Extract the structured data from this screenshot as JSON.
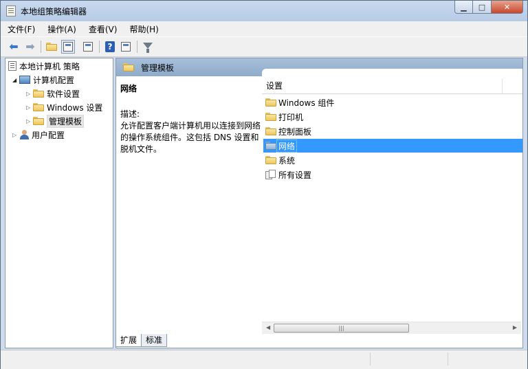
{
  "window": {
    "title": "本地组策略编辑器"
  },
  "menu": [
    "文件(F)",
    "操作(A)",
    "查看(V)",
    "帮助(H)"
  ],
  "toolbar": {
    "icons": [
      "back-arrow-icon",
      "forward-arrow-icon",
      "up-folder-icon",
      "show-hide-tree-icon",
      "export-list-icon",
      "help-icon",
      "properties-icon",
      "filter-icon"
    ]
  },
  "tree": {
    "root": "本地计算机 策略",
    "computer": "计算机配置",
    "software": "软件设置",
    "windows": "Windows 设置",
    "admin": "管理模板",
    "user": "用户配置"
  },
  "header": {
    "title": "管理模板"
  },
  "description": {
    "title": "网络",
    "label": "描述:",
    "text": "允许配置客户端计算机用以连接到网络的操作系统组件。这包括 DNS 设置和脱机文件。"
  },
  "list": {
    "column": "设置",
    "items": [
      "Windows 组件",
      "打印机",
      "控制面板",
      "网络",
      "系统",
      "所有设置"
    ],
    "selected": "网络"
  },
  "tabs": [
    "扩展",
    "标准"
  ]
}
